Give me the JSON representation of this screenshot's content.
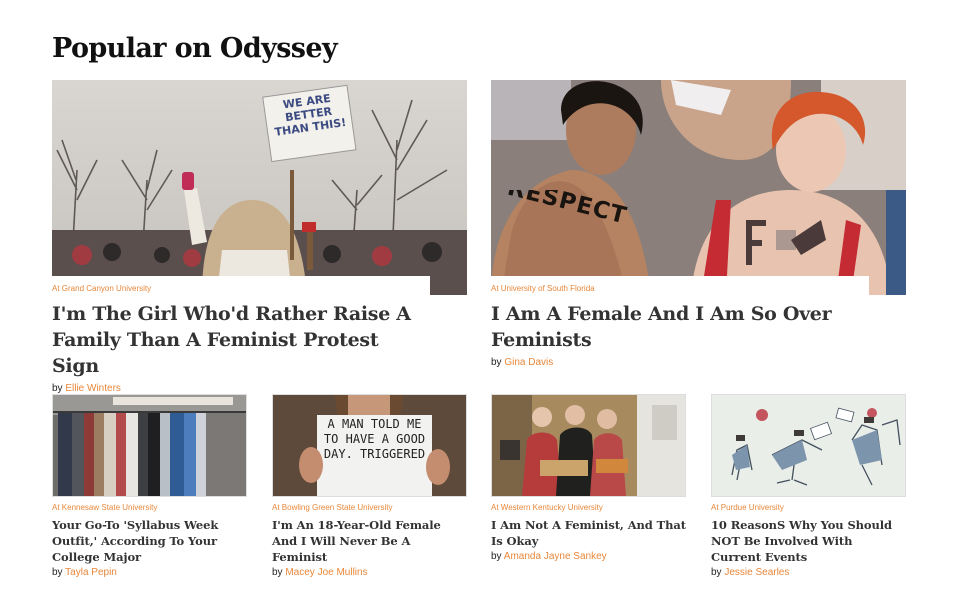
{
  "section": {
    "title": "Popular on Odyssey"
  },
  "featured": [
    {
      "school": "At Grand Canyon University",
      "title": "I'm The Girl Who'd Rather Raise A Family Than A Feminist Protest Sign",
      "by": "by",
      "author": "Ellie Winters",
      "sign_text": "WE ARE BETTER THAN THIS!"
    },
    {
      "school": "At University of South Florida",
      "title": "I Am A Female And I Am So Over Feminists",
      "by": "by",
      "author": "Gina Davis",
      "body_text": "RESPECT"
    }
  ],
  "cards": [
    {
      "school": "At Kennesaw State University",
      "title": "Your Go-To 'Syllabus Week Outfit,' According To Your College Major",
      "by": "by",
      "author": "Tayla Pepin"
    },
    {
      "school": "At Bowling Green State University",
      "title": "I'm An 18-Year-Old Female And I Will Never Be A Feminist",
      "by": "by",
      "author": "Macey Joe Mullins",
      "sign_text": "A MAN TOLD ME TO HAVE A GOOD DAY. TRIGGERED"
    },
    {
      "school": "At Western Kentucky University",
      "title": "I Am Not A Feminist, And That Is Okay",
      "by": "by",
      "author": "Amanda Jayne Sankey"
    },
    {
      "school": "At Purdue University",
      "title": "10 ReasonS Why You Should NOT Be Involved With Current Events",
      "by": "by",
      "author": "Jessie Searles"
    }
  ]
}
